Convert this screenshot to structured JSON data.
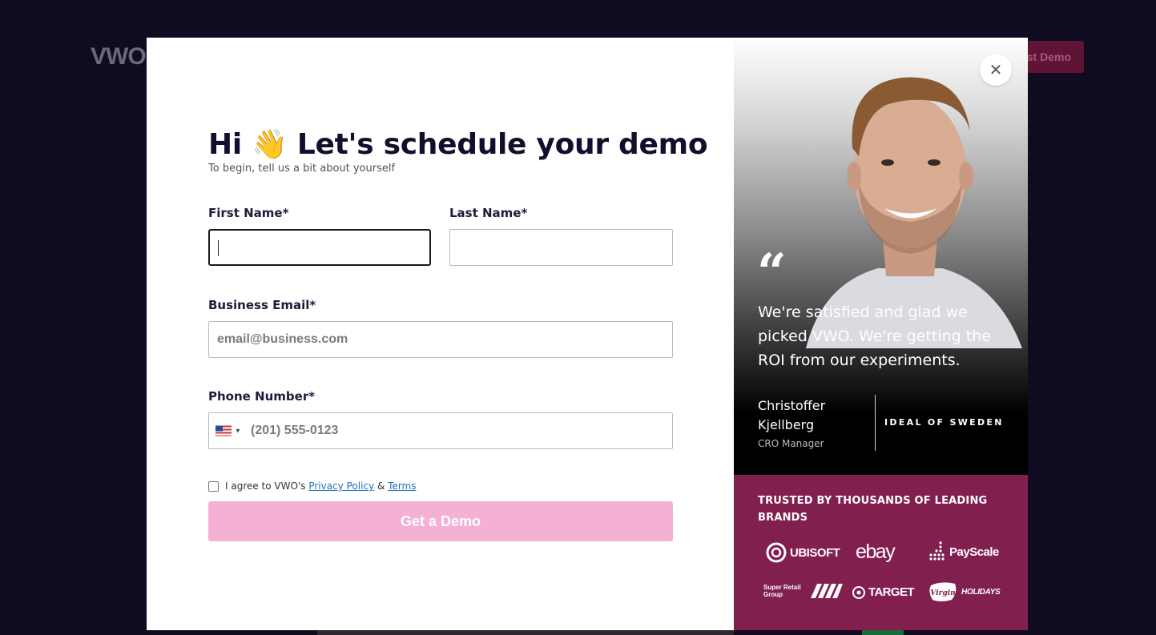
{
  "background": {
    "logo": "VWO",
    "cta_label": "st Demo"
  },
  "form": {
    "heading": "Hi 👋 Let's schedule your demo",
    "subheading": "To begin, tell us a bit about yourself",
    "first_name_label": "First Name*",
    "first_name_value": "",
    "last_name_label": "Last Name*",
    "last_name_value": "",
    "email_label": "Business Email*",
    "email_placeholder": "email@business.com",
    "phone_label": "Phone Number*",
    "phone_placeholder": "(201) 555-0123",
    "phone_country_icon": "us-flag-icon",
    "agree_prefix": "I agree to VWO's",
    "privacy_link": "Privacy Policy",
    "agree_and": "&",
    "terms_link": "Terms",
    "submit_label": "Get a Demo",
    "submit_color": "#f4b1d4"
  },
  "testimonial": {
    "close_icon": "close-icon",
    "quote_icon": "“",
    "quote": "We're satisfied and glad we picked VWO. We're getting the ROI from our experiments.",
    "person_name": "Christoffer Kjellberg",
    "person_role": "CRO Manager",
    "company": "IDEAL OF SWEDEN"
  },
  "brands": {
    "title": "TRUSTED BY THOUSANDS OF LEADING BRANDS",
    "background_color": "#811f4f",
    "logos": [
      {
        "name": "UBISOFT"
      },
      {
        "name": "ebay"
      },
      {
        "name": "PayScale"
      },
      {
        "name": "Super Retail Group"
      },
      {
        "name": "TARGET"
      },
      {
        "name": "HOLIDAYS",
        "prefix": "Virgin"
      }
    ]
  }
}
